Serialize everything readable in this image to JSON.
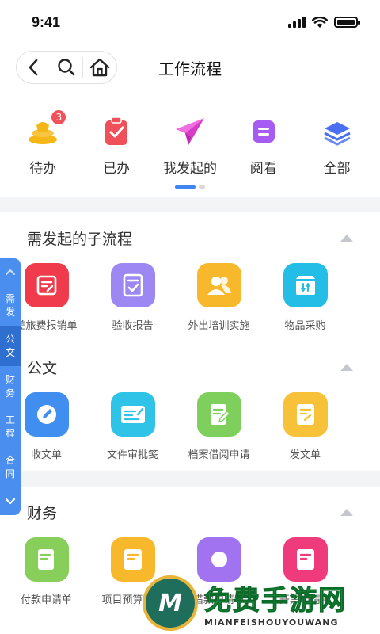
{
  "status_bar": {
    "time": "9:41",
    "battery_level": 1.0
  },
  "header": {
    "title": "工作流程"
  },
  "quick_tabs": [
    {
      "label": "待办",
      "icon": "todo-stack-icon",
      "badge": "3",
      "color": "#f5b617"
    },
    {
      "label": "已办",
      "icon": "done-clipboard-icon",
      "color": "#f0505a"
    },
    {
      "label": "我发起的",
      "icon": "paper-plane-icon",
      "color": "#e94fd9"
    },
    {
      "label": "阅看",
      "icon": "read-doc-icon",
      "color": "#a65cf0"
    },
    {
      "label": "全部",
      "icon": "layers-icon",
      "color": "#4a6ff0"
    }
  ],
  "pager": {
    "current": 1,
    "total": 2
  },
  "sections": [
    {
      "title": "需发起的子流程",
      "items": [
        {
          "label": "差旅费报销单",
          "icon": "expense-form-icon",
          "color": "#ef3b4b"
        },
        {
          "label": "验收报告",
          "icon": "report-check-icon",
          "color": "#9d88f3"
        },
        {
          "label": "外出培训实施",
          "icon": "people-icon",
          "color": "#f7b92b"
        },
        {
          "label": "物品采购",
          "icon": "purchase-box-icon",
          "color": "#23bde6"
        }
      ]
    },
    {
      "title": "公文",
      "items": [
        {
          "label": "收文单",
          "icon": "pen-circle-icon",
          "color": "#3f8ef0"
        },
        {
          "label": "文件审批笺",
          "icon": "approval-card-icon",
          "color": "#2fc3e8"
        },
        {
          "label": "档案借阅申请",
          "icon": "archive-edit-icon",
          "color": "#7fcf5c"
        },
        {
          "label": "发文单",
          "icon": "dispatch-doc-icon",
          "color": "#f7c13a"
        }
      ]
    },
    {
      "title": "财务",
      "items": [
        {
          "label": "付款申请单",
          "icon": "payment-edit-icon",
          "color": "#88ce5a"
        },
        {
          "label": "项目预算申请",
          "icon": "budget-doc-icon",
          "color": "#f7b92b"
        },
        {
          "label": "借款申请单",
          "icon": "loan-icon",
          "color": "#a273f0"
        },
        {
          "label": "开票申请单",
          "icon": "invoice-icon",
          "color": "#ef3b7b"
        }
      ]
    }
  ],
  "side_tabs": [
    {
      "label": "需发",
      "active": false
    },
    {
      "label": "公文",
      "active": true
    },
    {
      "label": "财务",
      "active": false
    },
    {
      "label": "工程",
      "active": false
    },
    {
      "label": "合同",
      "active": false
    }
  ],
  "watermark": {
    "main": "免费手游网",
    "sub": "MIANFEISHOUYOUWANG",
    "logo_letter": "M"
  }
}
